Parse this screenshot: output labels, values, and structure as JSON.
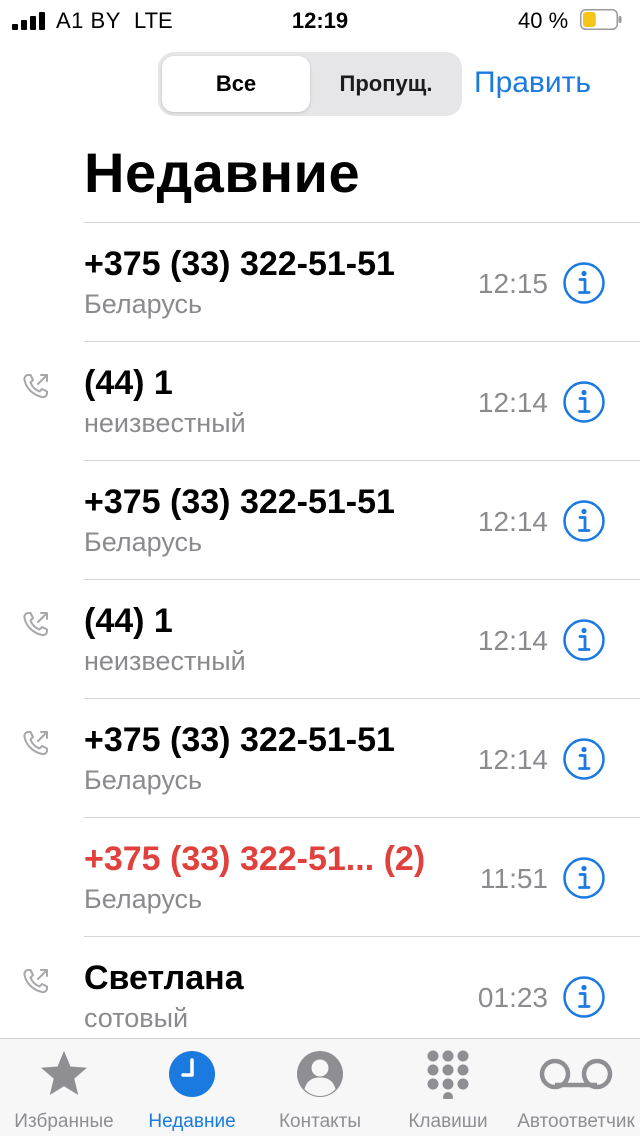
{
  "status_bar": {
    "carrier": "A1 BY",
    "network": "LTE",
    "time": "12:19",
    "battery_percent": "40 %",
    "battery_level": 0.4,
    "battery_color": "#f5c518"
  },
  "header": {
    "segments": [
      {
        "label": "Все",
        "selected": true
      },
      {
        "label": "Пропущ.",
        "selected": false
      }
    ],
    "edit_label": "Править",
    "title": "Недавние"
  },
  "calls": [
    {
      "name": "+375 (33) 322-51-51",
      "subtitle": "Беларусь",
      "time": "12:15",
      "outgoing": false,
      "missed": false
    },
    {
      "name": "(44) 1",
      "subtitle": "неизвестный",
      "time": "12:14",
      "outgoing": true,
      "missed": false
    },
    {
      "name": "+375 (33) 322-51-51",
      "subtitle": "Беларусь",
      "time": "12:14",
      "outgoing": false,
      "missed": false
    },
    {
      "name": "(44) 1",
      "subtitle": "неизвестный",
      "time": "12:14",
      "outgoing": true,
      "missed": false
    },
    {
      "name": "+375 (33) 322-51-51",
      "subtitle": "Беларусь",
      "time": "12:14",
      "outgoing": true,
      "missed": false
    },
    {
      "name": "+375 (33) 322-51...  (2)",
      "subtitle": "Беларусь",
      "time": "11:51",
      "outgoing": false,
      "missed": true
    },
    {
      "name": "Светлана",
      "subtitle": "сотовый",
      "time": "01:23",
      "outgoing": true,
      "missed": false
    }
  ],
  "tab_bar": {
    "tabs": [
      {
        "label": "Избранные",
        "icon": "star-icon",
        "active": false
      },
      {
        "label": "Недавние",
        "icon": "clock-icon",
        "active": true
      },
      {
        "label": "Контакты",
        "icon": "contact-icon",
        "active": false
      },
      {
        "label": "Клавиши",
        "icon": "keypad-icon",
        "active": false
      },
      {
        "label": "Автоответчик",
        "icon": "voicemail-icon",
        "active": false
      }
    ]
  },
  "colors": {
    "accent": "#1a7ae0",
    "missed": "#e0413c",
    "secondary_text": "#8b8b8f"
  }
}
